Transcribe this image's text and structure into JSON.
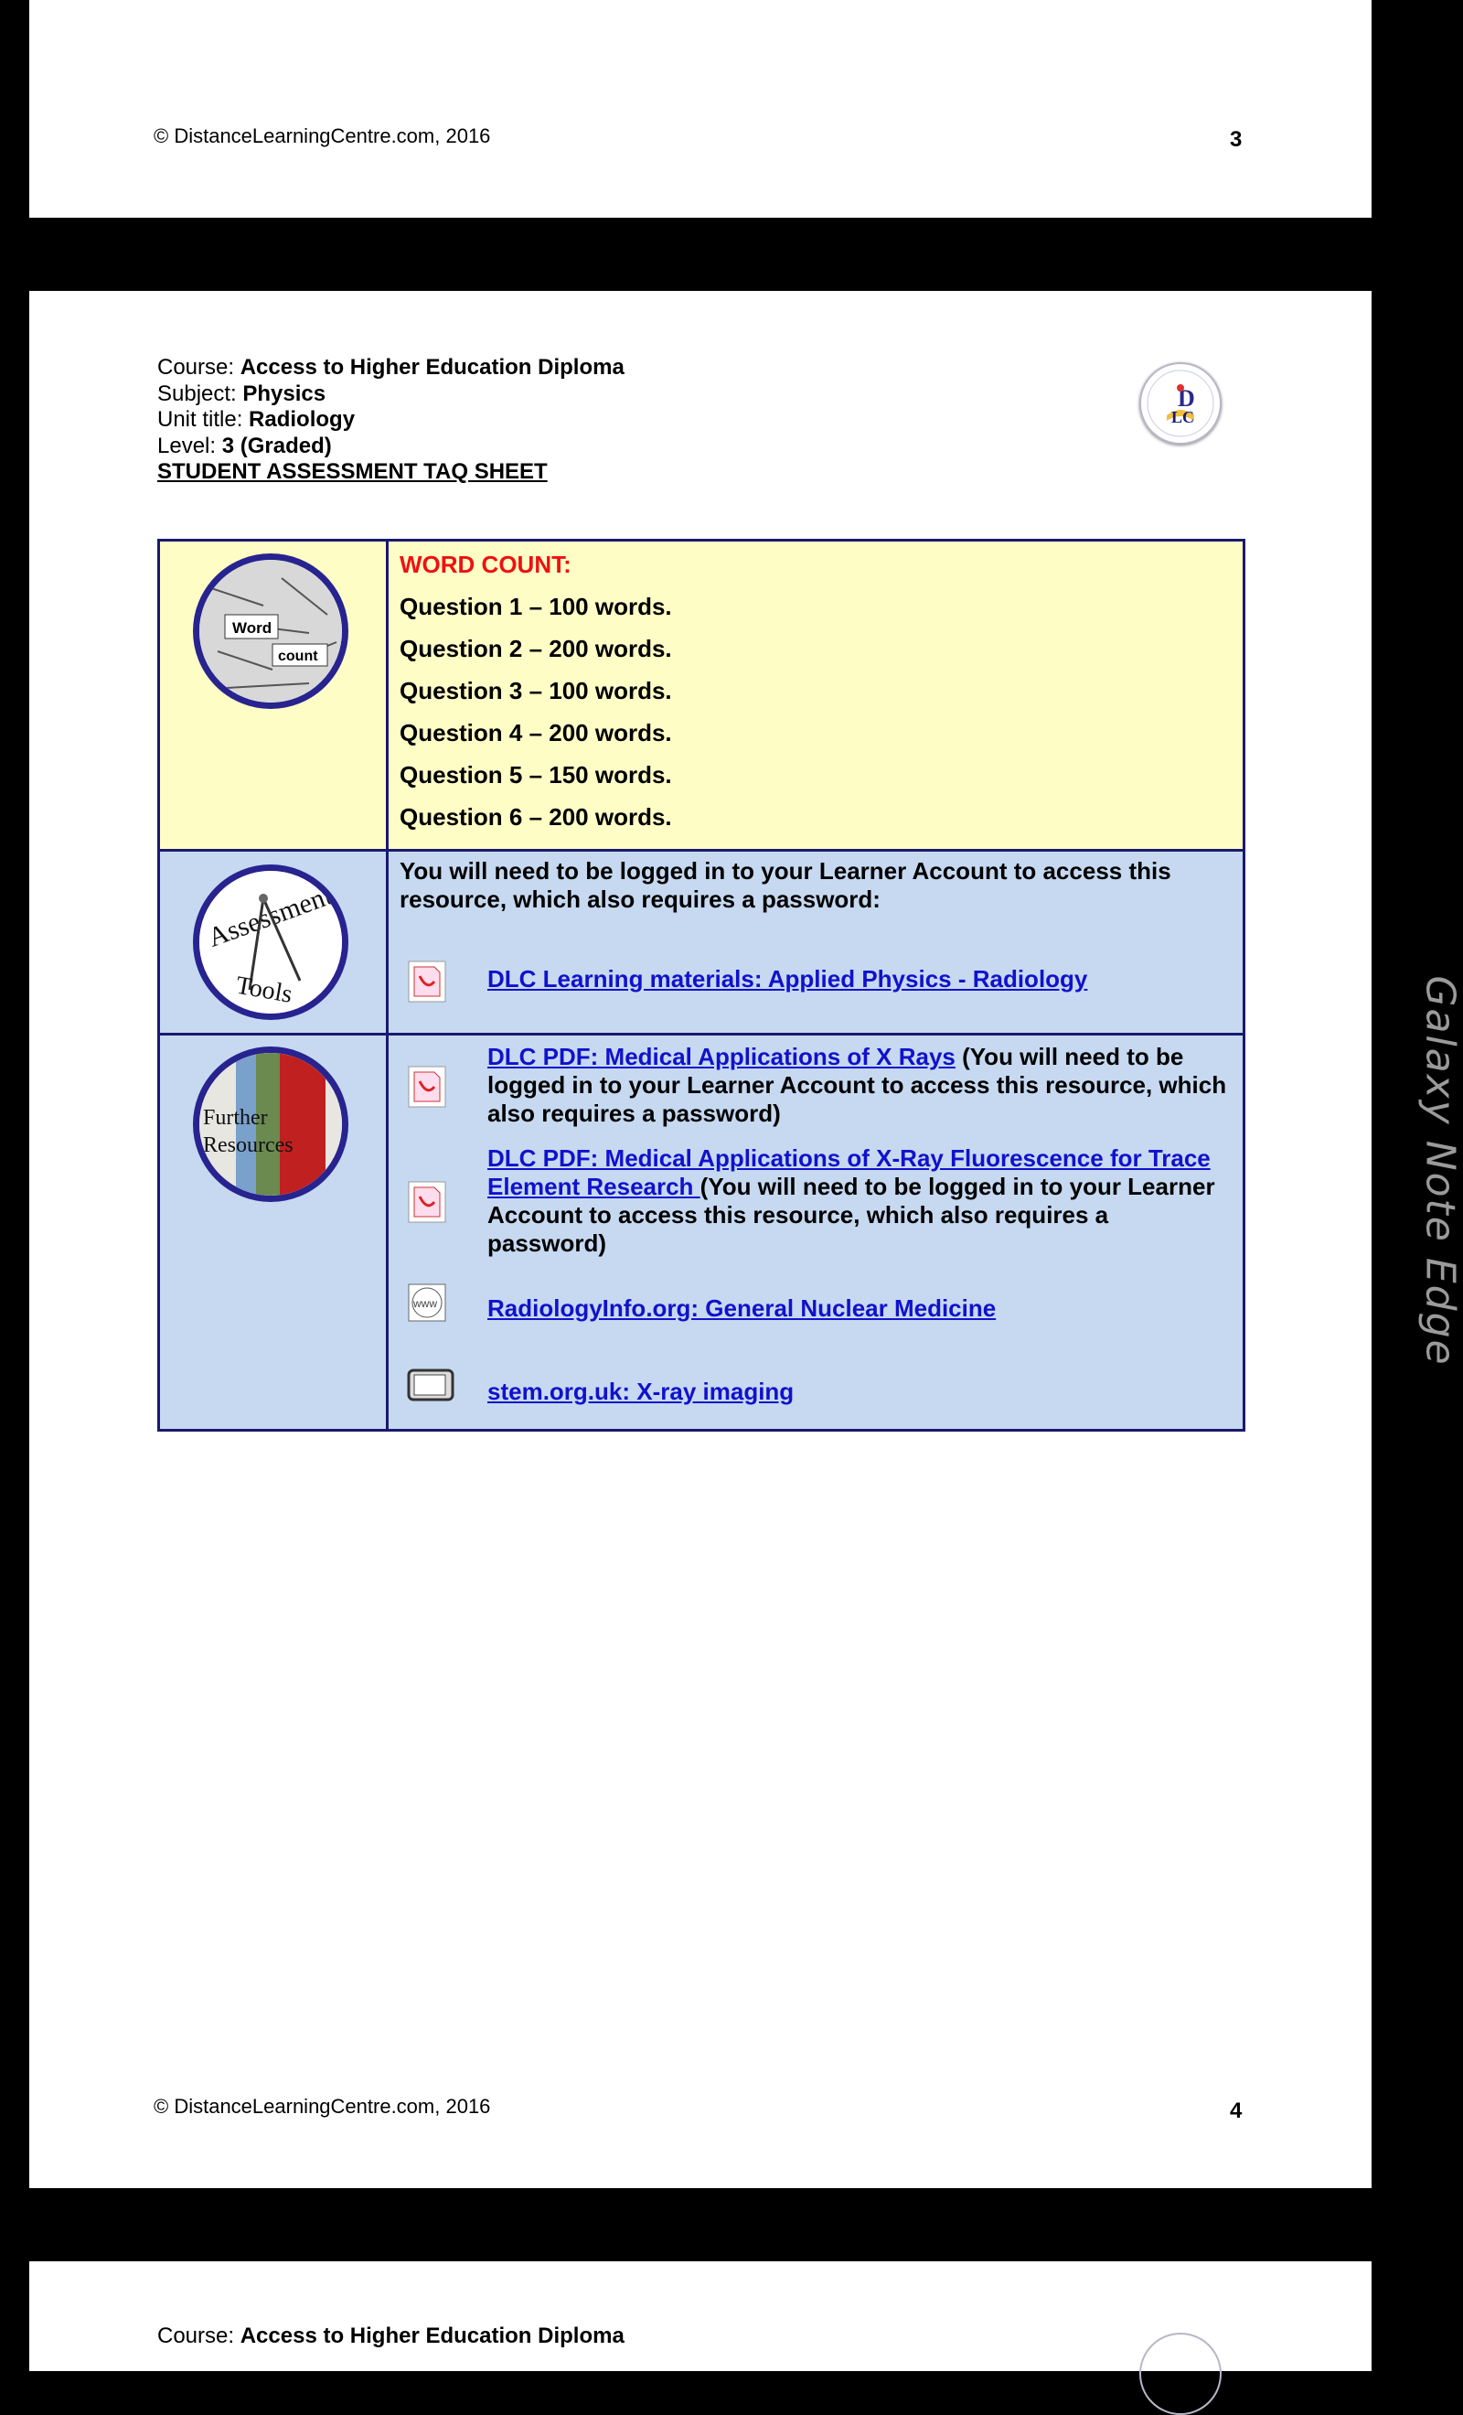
{
  "page3": {
    "copyright": "© DistanceLearningCentre.com, 2016",
    "page_number": "3"
  },
  "page4": {
    "course_label": "Course:",
    "course": "Access to Higher Education Diploma",
    "subject_label": "Subject:",
    "subject": "Physics",
    "unit_label": "Unit title:",
    "unit": "Radiology",
    "level_label": "Level:",
    "level": "3 (Graded)",
    "sheet_title": "STUDENT ASSESSMENT TAQ SHEET",
    "word_count": {
      "title": "WORD COUNT:",
      "badge_word": "Word",
      "badge_count": "count",
      "questions": [
        "Question 1 – 100 words.",
        "Question 2 – 200 words.",
        "Question 3 – 100 words.",
        "Question 4 – 200 words.",
        "Question 5 – 150 words.",
        "Question 6 – 200 words."
      ]
    },
    "assessment": {
      "badge_top": "Assessment",
      "badge_bottom": "Tools",
      "note": "You will need to be logged in to your Learner Account to access this resource, which also requires a password:",
      "link": "DLC Learning materials: Applied Physics - Radiology"
    },
    "further": {
      "badge_line1": "Further",
      "badge_line2": "Resources",
      "items": [
        {
          "link": "DLC PDF: Medical Applications of X Rays",
          "suffix": " (You will need to be logged in to your Learner Account to access this resource, which also requires a password)",
          "icon": "pdf-icon"
        },
        {
          "link": "DLC PDF: Medical Applications of X-Ray Fluorescence for Trace Element Research ",
          "suffix": "(You will need to be logged in to your Learner Account to access this resource, which also requires a password)",
          "icon": "pdf-icon"
        },
        {
          "link": "RadiologyInfo.org: General Nuclear Medicine",
          "suffix": "",
          "icon": "www-icon"
        },
        {
          "link": "stem.org.uk: X-ray imaging",
          "suffix": "",
          "icon": "tv-icon"
        }
      ]
    },
    "copyright": "© DistanceLearningCentre.com, 2016",
    "page_number": "4"
  },
  "page5": {
    "course_label": "Course:",
    "course": "Access to Higher Education Diploma"
  },
  "watermark": "Galaxy Note Edge",
  "colors": {
    "border": "#1a1a6e",
    "yellow": "#fffdc6",
    "blue": "#c6d9f1",
    "red": "#ee1111",
    "link": "#1111cc"
  }
}
